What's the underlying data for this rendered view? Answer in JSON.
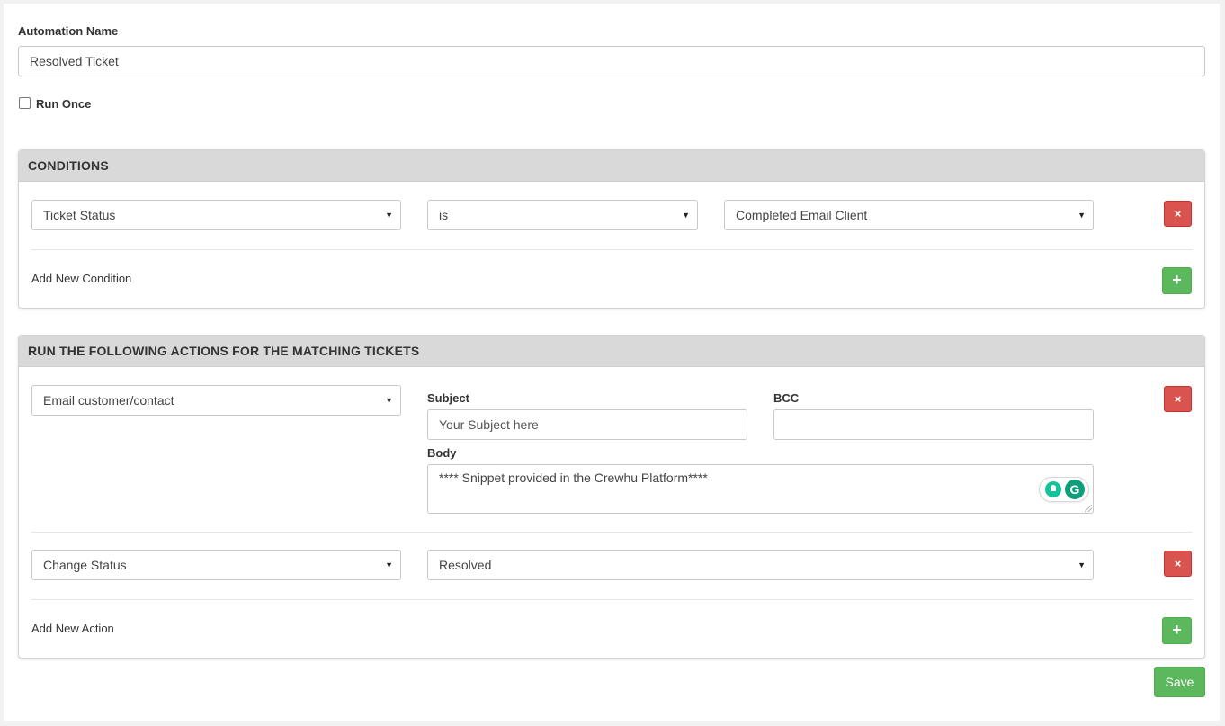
{
  "automation": {
    "name_label": "Automation Name",
    "name_value": "Resolved Ticket",
    "run_once_label": "Run Once",
    "run_once_checked": false
  },
  "conditions": {
    "header": "CONDITIONS",
    "rows": [
      {
        "field": "Ticket Status",
        "operator": "is",
        "value": "Completed Email Client"
      }
    ],
    "add_label": "Add New Condition",
    "remove_icon": "×",
    "add_icon": "+"
  },
  "actions": {
    "header": "RUN THE FOLLOWING ACTIONS FOR THE MATCHING TICKETS",
    "email_action": {
      "type": "Email customer/contact",
      "subject_label": "Subject",
      "subject_placeholder": "Your Subject here",
      "bcc_label": "BCC",
      "bcc_value": "",
      "body_label": "Body",
      "body_value": "**** Snippet provided in the Crewhu Platform****",
      "grammarly_letter": "G"
    },
    "status_action": {
      "type": "Change Status",
      "value": "Resolved"
    },
    "add_label": "Add New Action",
    "remove_icon": "×",
    "add_icon": "+"
  },
  "save_label": "Save",
  "caret": "▼",
  "colors": {
    "danger": "#d9534f",
    "success": "#5cb85c",
    "panel_header": "#d9d9d9",
    "grammarly": "#15c39a"
  }
}
